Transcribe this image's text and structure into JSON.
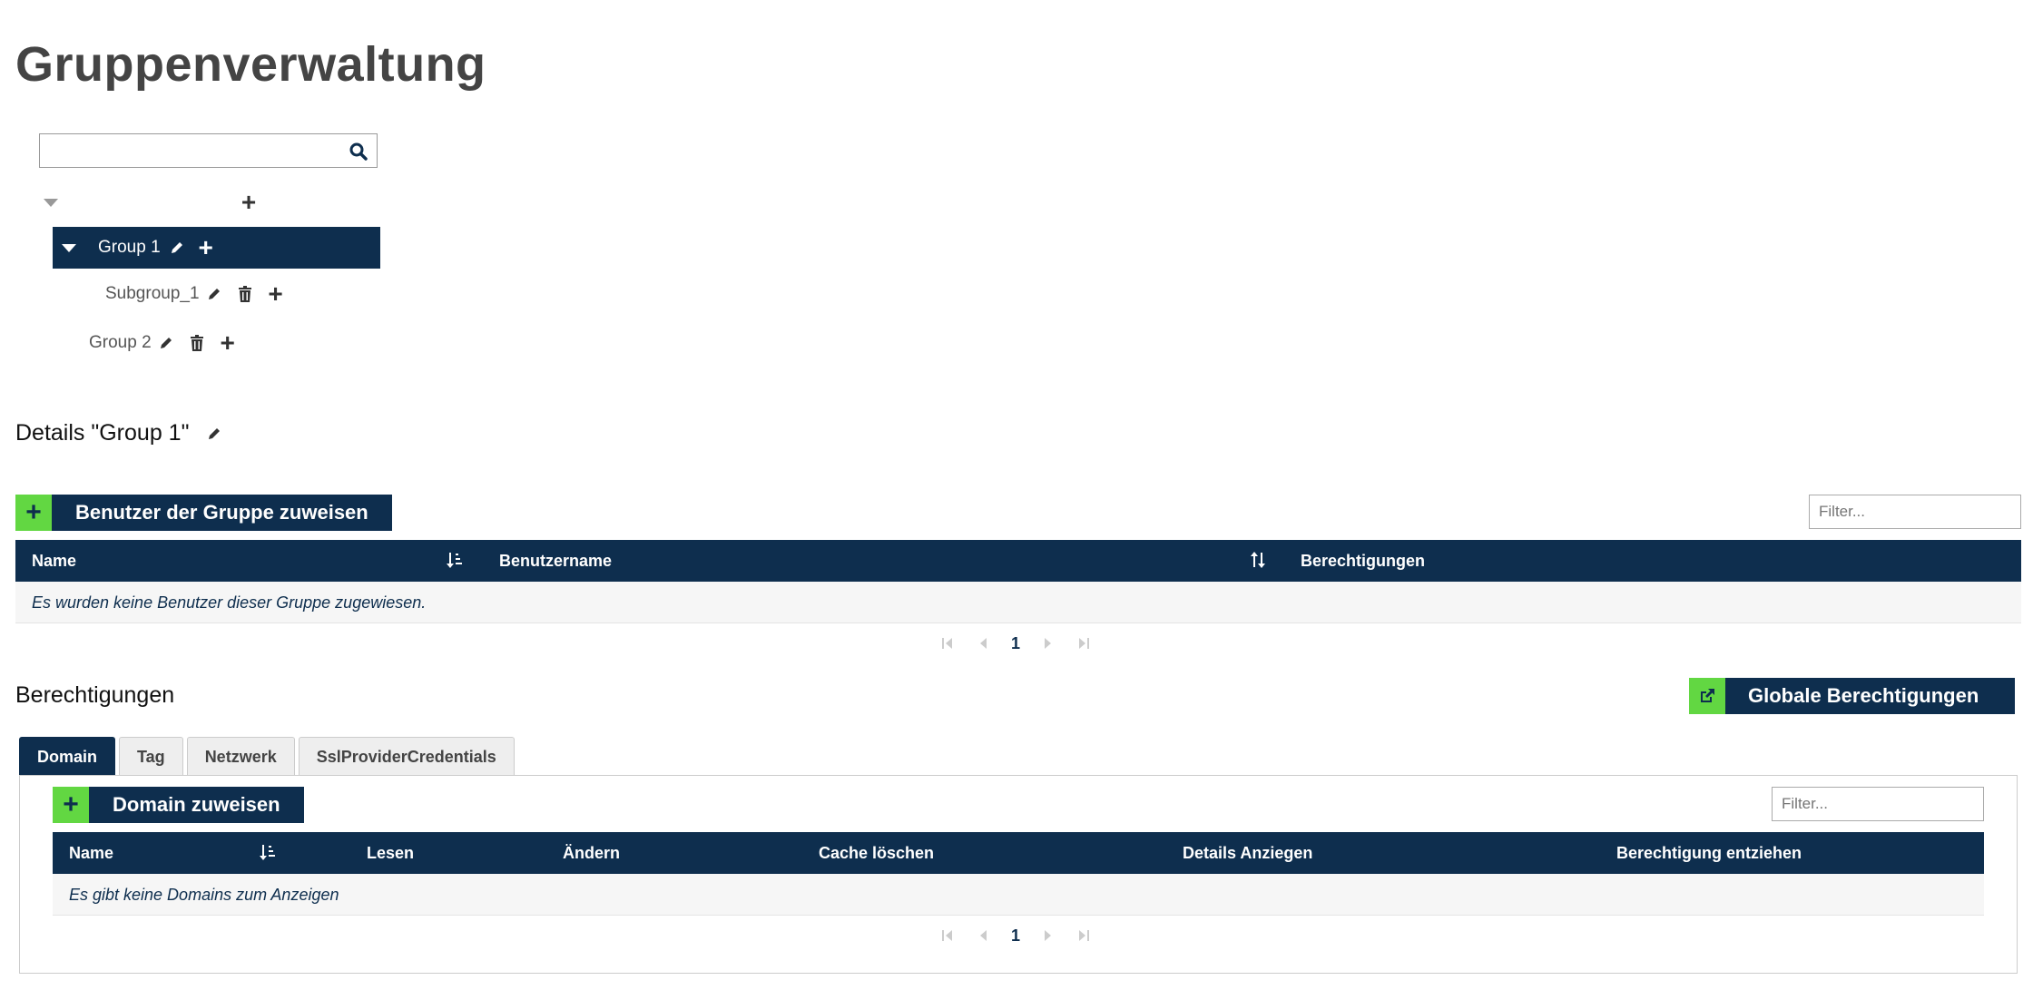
{
  "page": {
    "title": "Gruppenverwaltung"
  },
  "tree": {
    "search_placeholder": "",
    "groups": [
      {
        "label": "Group 1"
      },
      {
        "label": "Subgroup_1"
      },
      {
        "label": "Group 2"
      }
    ]
  },
  "details": {
    "title": "Details \"Group 1\"",
    "assign_button": "Benutzer der Gruppe zuweisen",
    "filter_placeholder": "Filter...",
    "columns": [
      "Name",
      "Benutzername",
      "Berechtigungen"
    ],
    "empty_text": "Es wurden keine Benutzer dieser Gruppe zugewiesen.",
    "page": "1"
  },
  "permissions": {
    "title": "Berechtigungen",
    "global_button": "Globale Berechtigungen",
    "tabs": [
      "Domain",
      "Tag",
      "Netzwerk",
      "SslProviderCredentials"
    ],
    "assign_button": "Domain zuweisen",
    "filter_placeholder": "Filter...",
    "columns": [
      "Name",
      "Lesen",
      "Ändern",
      "Cache löschen",
      "Details Anziegen",
      "Berechtigung entziehen"
    ],
    "empty_text": "Es gibt keine Domains zum Anzeigen",
    "page": "1"
  },
  "colors": {
    "primary": "#0e2e4e",
    "accent": "#62d742",
    "title": "#444444"
  }
}
